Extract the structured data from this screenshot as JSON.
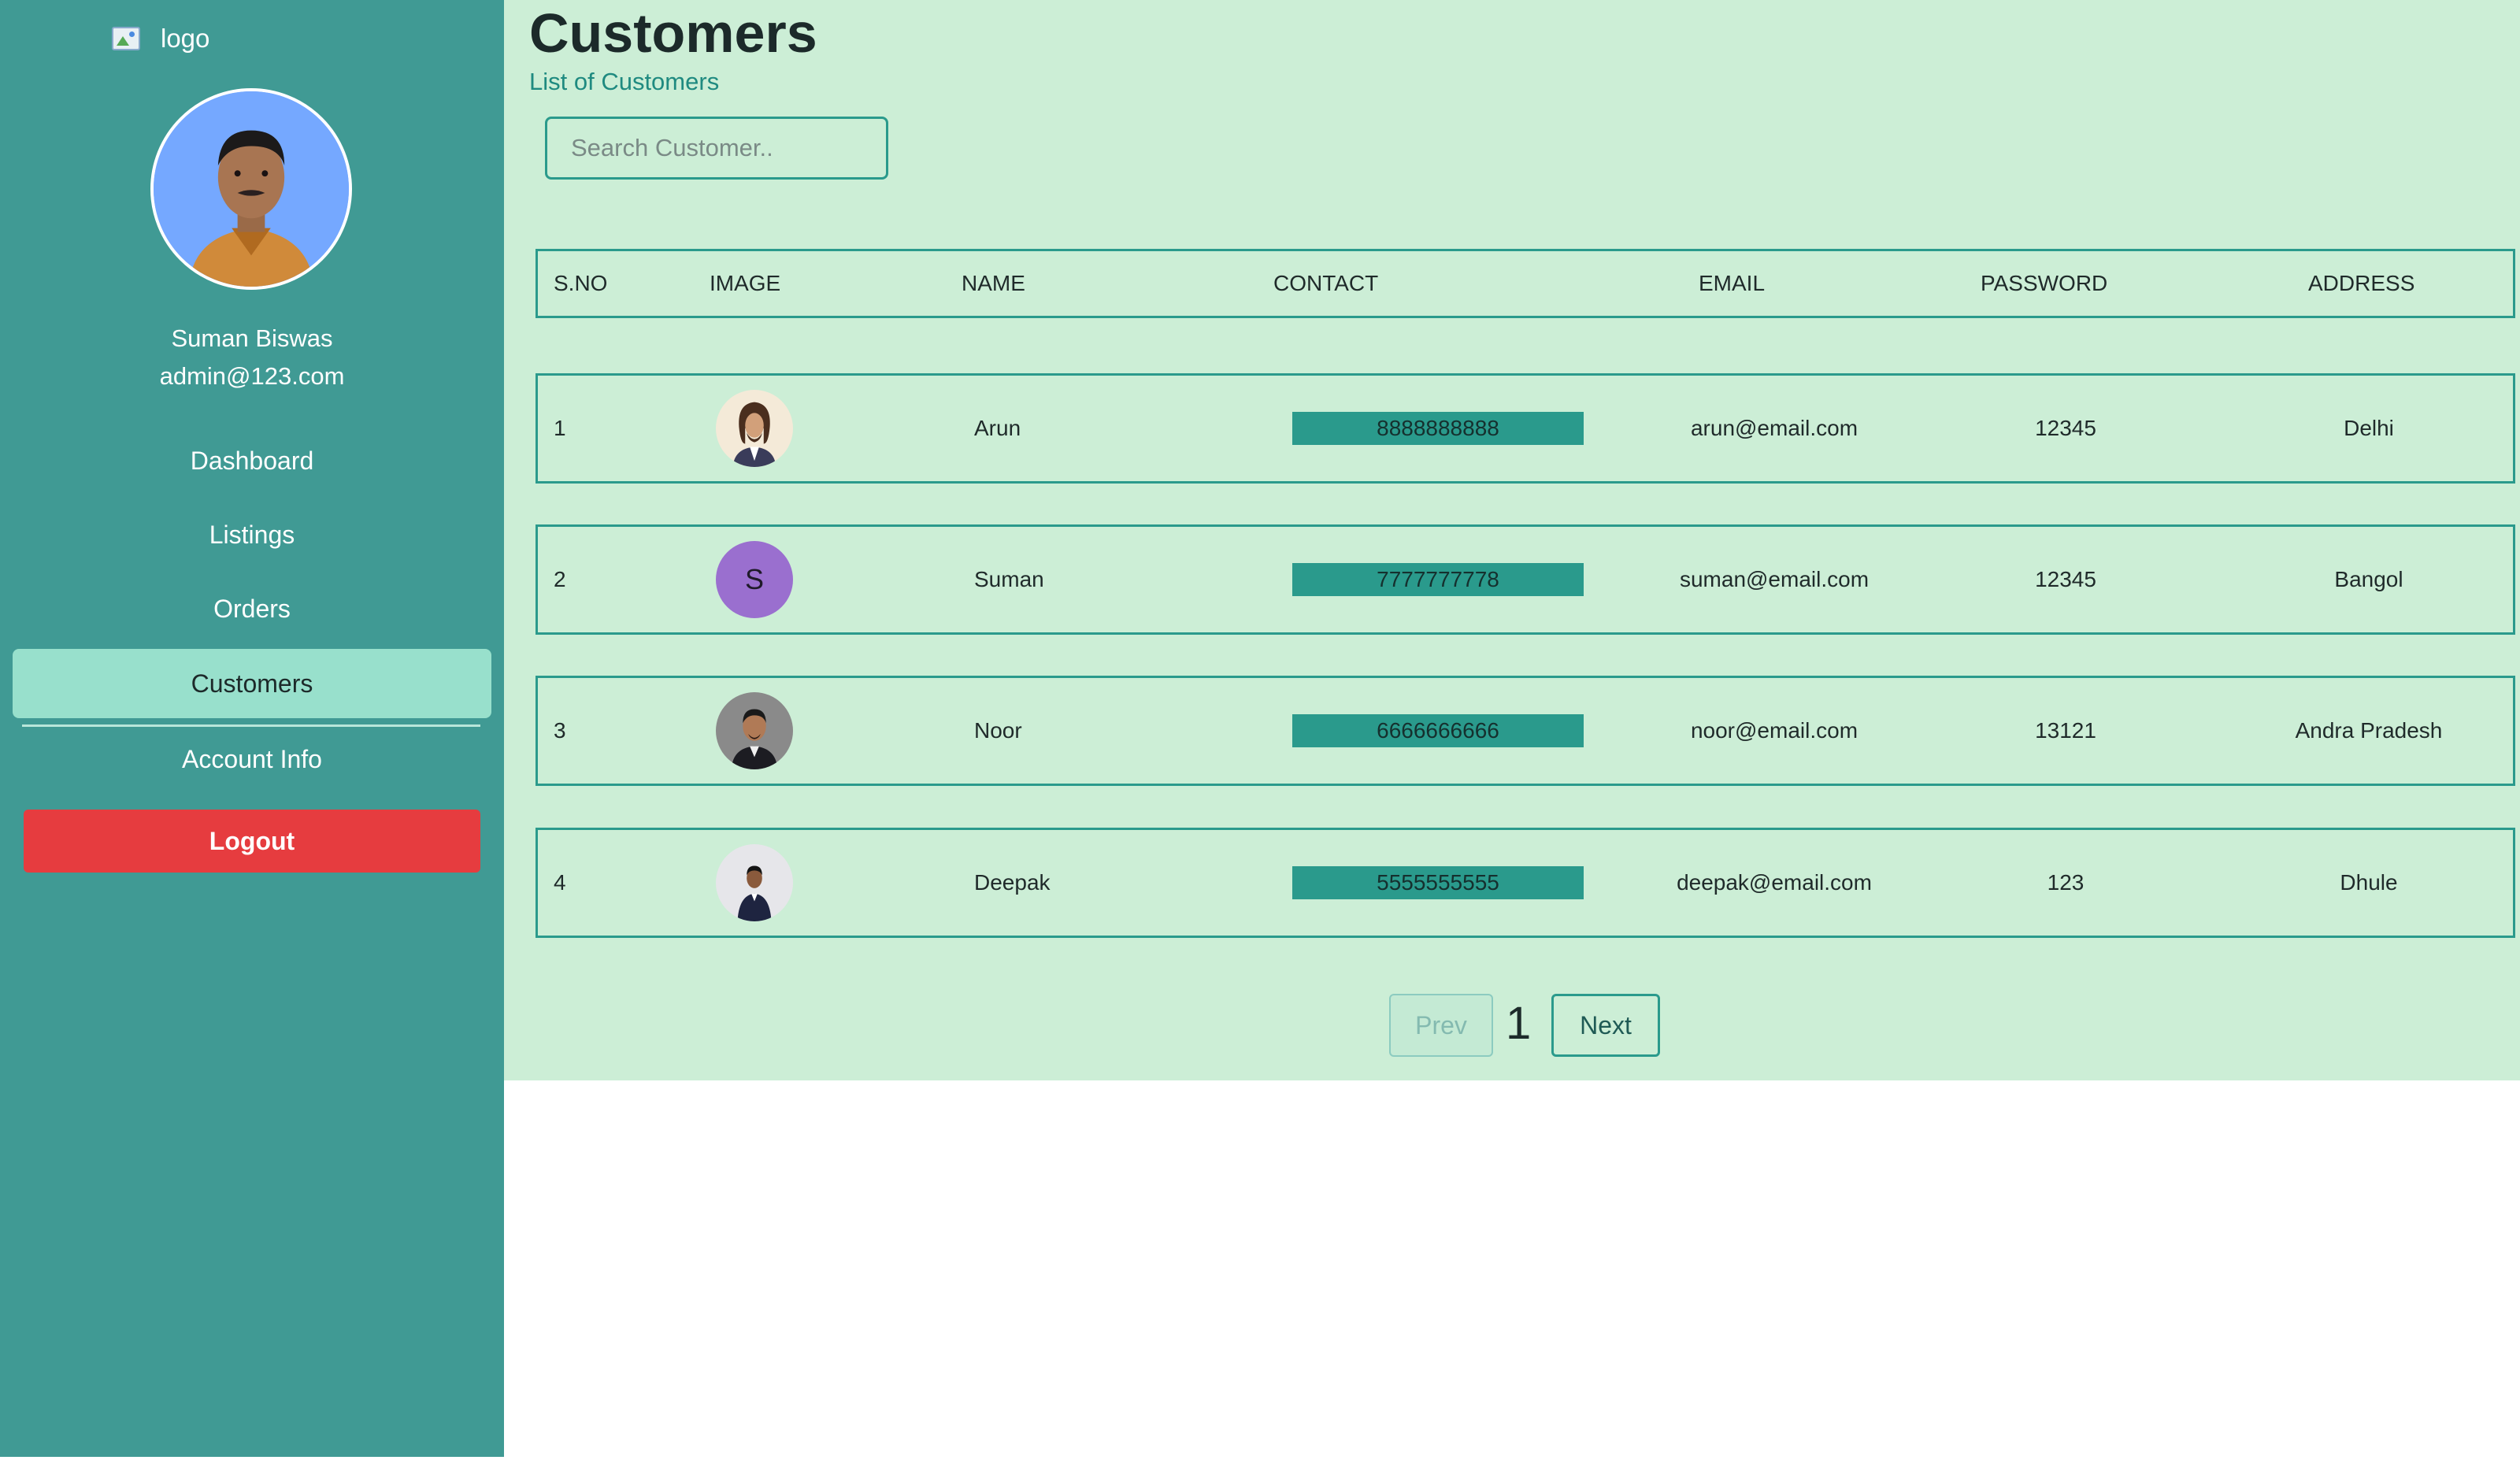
{
  "sidebar": {
    "logo_alt": "logo",
    "user_name": "Suman Biswas",
    "user_email": "admin@123.com",
    "nav": [
      {
        "label": "Dashboard"
      },
      {
        "label": "Listings"
      },
      {
        "label": "Orders"
      },
      {
        "label": "Customers",
        "active": true
      },
      {
        "label": "Account Info"
      }
    ],
    "logout_label": "Logout"
  },
  "header": {
    "title": "Customers",
    "subtitle": "List of Customers"
  },
  "search": {
    "placeholder": "Search Customer..",
    "value": ""
  },
  "table": {
    "columns": [
      "S.NO",
      "IMAGE",
      "NAME",
      "CONTACT",
      "EMAIL",
      "PASSWORD",
      "ADDRESS"
    ],
    "rows": [
      {
        "sno": "1",
        "image": "avatar-photo",
        "name": "Arun",
        "contact": "8888888888",
        "email": "arun@email.com",
        "password": "12345",
        "address": "Delhi"
      },
      {
        "sno": "2",
        "image": "letter-avatar",
        "letter": "S",
        "name": "Suman",
        "contact": "7777777778",
        "email": "suman@email.com",
        "password": "12345",
        "address": "Bangol"
      },
      {
        "sno": "3",
        "image": "avatar-photo",
        "name": "Noor",
        "contact": "6666666666",
        "email": "noor@email.com",
        "password": "13121",
        "address": "Andra Pradesh"
      },
      {
        "sno": "4",
        "image": "avatar-photo",
        "name": "Deepak",
        "contact": "5555555555",
        "email": "deepak@email.com",
        "password": "123",
        "address": "Dhule"
      }
    ]
  },
  "pagination": {
    "prev_label": "Prev",
    "current_page": "1",
    "next_label": "Next"
  },
  "colors": {
    "sidebar_bg": "#409a94",
    "main_bg": "#cceed6",
    "accent": "#2a9a8c",
    "active_nav": "#98e0cc",
    "logout": "#e63c3f"
  }
}
